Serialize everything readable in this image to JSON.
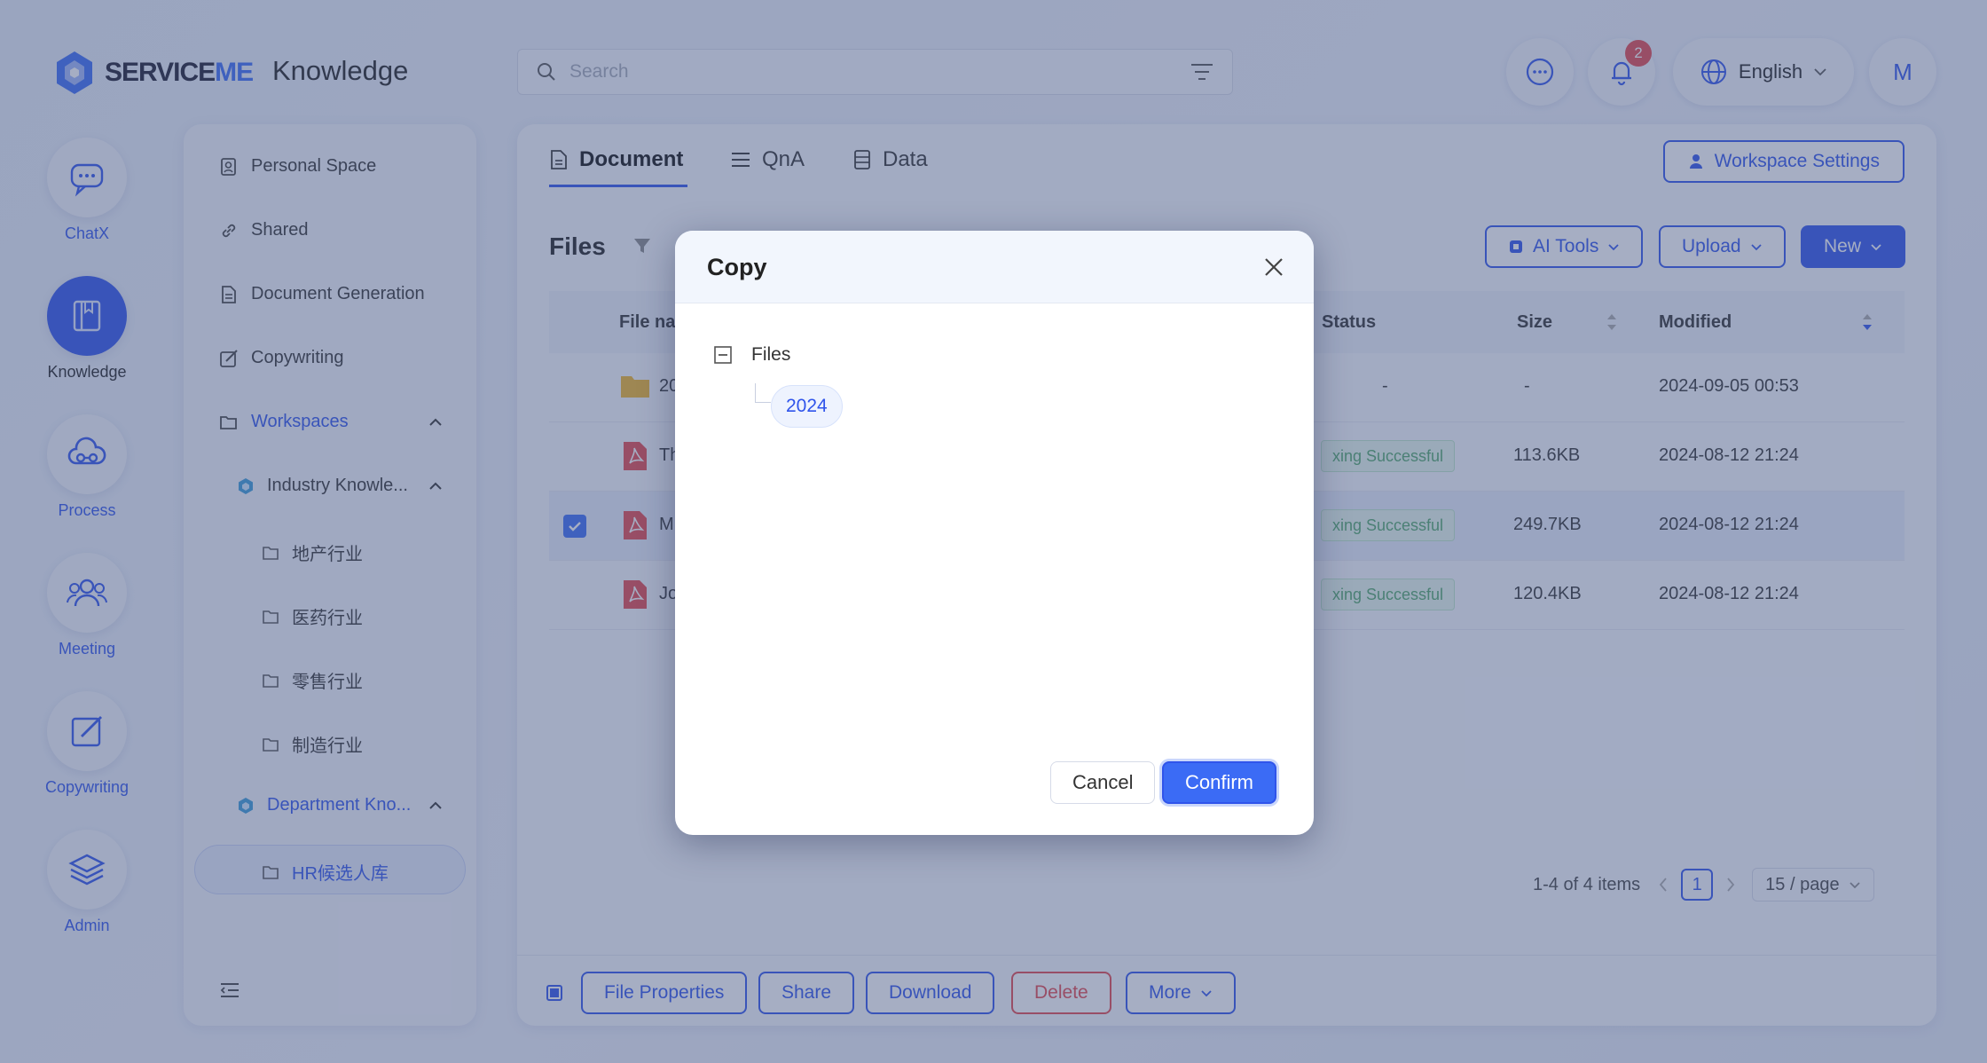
{
  "header": {
    "logo_prefix": "SERVICE",
    "logo_suffix": "ME",
    "product": "Knowledge",
    "search_placeholder": "Search",
    "notifications_count": "2",
    "language": "English",
    "avatar_initial": "M"
  },
  "rail": [
    {
      "label": "ChatX",
      "icon": "chat-icon"
    },
    {
      "label": "Knowledge",
      "icon": "book-icon"
    },
    {
      "label": "Process",
      "icon": "process-icon"
    },
    {
      "label": "Meeting",
      "icon": "meeting-icon"
    },
    {
      "label": "Copywriting",
      "icon": "edit-icon"
    },
    {
      "label": "Admin",
      "icon": "layers-icon"
    }
  ],
  "sidenav": {
    "personal": "Personal Space",
    "shared": "Shared",
    "docgen": "Document Generation",
    "copywriting": "Copywriting",
    "workspaces": "Workspaces",
    "industry": "Industry Knowle...",
    "industry_children": [
      "地产行业",
      "医药行业",
      "零售行业",
      "制造行业"
    ],
    "department": "Department Kno...",
    "department_children": [
      "HR候选人库"
    ]
  },
  "main": {
    "tabs": [
      "Document",
      "QnA",
      "Data"
    ],
    "workspace_settings": "Workspace Settings",
    "files_title": "Files",
    "ai_tools": "AI Tools",
    "upload": "Upload",
    "new": "New",
    "columns": {
      "file_name": "File na",
      "status": "Status",
      "size": "Size",
      "modified": "Modified"
    },
    "rows": [
      {
        "name": "20",
        "status": "-",
        "size": "-",
        "modified": "2024-09-05 00:53"
      },
      {
        "name": "Th",
        "status": "xing Successful",
        "size": "113.6KB",
        "modified": "2024-08-12 21:24"
      },
      {
        "name": "M",
        "status": "xing Successful",
        "size": "249.7KB",
        "modified": "2024-08-12 21:24"
      },
      {
        "name": "Jo",
        "status": "xing Successful",
        "size": "120.4KB",
        "modified": "2024-08-12 21:24"
      }
    ],
    "pager": {
      "summary": "1-4 of 4 items",
      "page": "1",
      "per_page": "15 / page"
    },
    "bottom": {
      "properties": "File Properties",
      "share": "Share",
      "download": "Download",
      "delete": "Delete",
      "more": "More"
    }
  },
  "modal": {
    "title": "Copy",
    "tree_root": "Files",
    "tree_child": "2024",
    "cancel": "Cancel",
    "confirm": "Confirm"
  },
  "colors": {
    "accent": "#2f54eb",
    "danger": "#e5484d",
    "success": "#52a86a"
  }
}
